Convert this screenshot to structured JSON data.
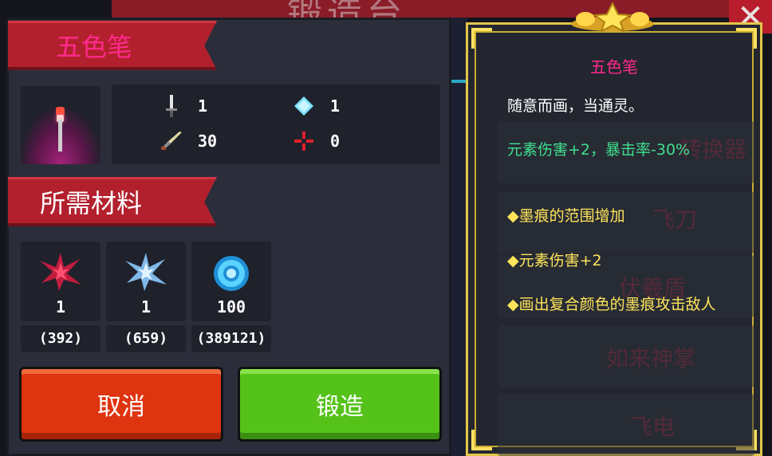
{
  "background": {
    "title": "锻造台",
    "close_glyph": "✕",
    "list_items": [
      "转换器",
      "飞刀",
      "伏羲盾",
      "如来神掌",
      "飞电"
    ]
  },
  "item": {
    "name": "五色笔",
    "stats": {
      "attack": "1",
      "energy": "1",
      "crit": "30",
      "accuracy": "0"
    }
  },
  "materials": {
    "header": "所需材料",
    "items": [
      {
        "icon": "red-shard-icon",
        "required": "1",
        "owned": "(392)"
      },
      {
        "icon": "blue-shard-icon",
        "required": "1",
        "owned": "(659)"
      },
      {
        "icon": "gem-coin-icon",
        "required": "100",
        "owned": "(389121)"
      }
    ]
  },
  "buttons": {
    "cancel": "取消",
    "forge": "锻造"
  },
  "details": {
    "title": "五色笔",
    "description": "随意而画，当通灵。",
    "effect": "元素伤害+2，暴击率-30%",
    "traits": [
      "◆墨痕的范围增加",
      "◆元素伤害+2",
      "◆画出复合颜色的墨痕攻击敌人"
    ]
  },
  "colors": {
    "name": "#ff2a8c",
    "effect": "#3fe08e",
    "trait": "#ffe45a",
    "cancel": "#de3410",
    "forge": "#55c21a",
    "frame": "#e2c64a"
  }
}
